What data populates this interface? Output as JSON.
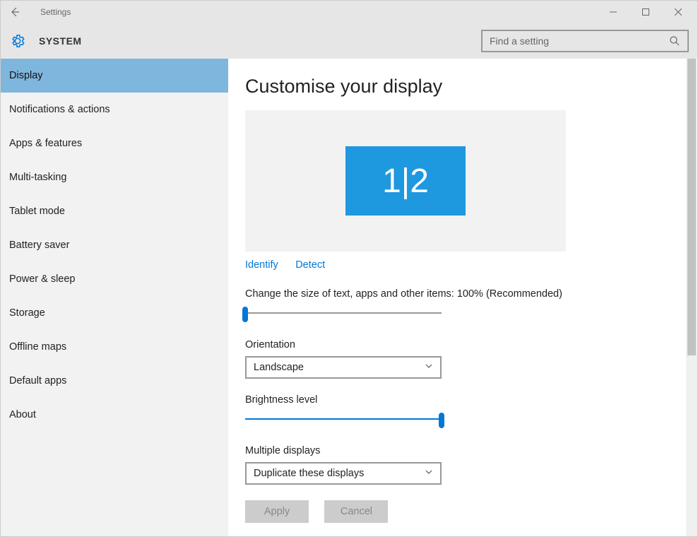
{
  "window": {
    "title": "Settings"
  },
  "header": {
    "title": "SYSTEM"
  },
  "search": {
    "placeholder": "Find a setting"
  },
  "sidebar": {
    "items": [
      {
        "label": "Display"
      },
      {
        "label": "Notifications & actions"
      },
      {
        "label": "Apps & features"
      },
      {
        "label": "Multi-tasking"
      },
      {
        "label": "Tablet mode"
      },
      {
        "label": "Battery saver"
      },
      {
        "label": "Power & sleep"
      },
      {
        "label": "Storage"
      },
      {
        "label": "Offline maps"
      },
      {
        "label": "Default apps"
      },
      {
        "label": "About"
      }
    ],
    "active_index": 0
  },
  "main": {
    "heading": "Customise your display",
    "monitor_label": "1|2",
    "links": {
      "identify": "Identify",
      "detect": "Detect"
    },
    "scale": {
      "label": "Change the size of text, apps and other items: 100% (Recommended)",
      "value_pct": 0
    },
    "orientation": {
      "label": "Orientation",
      "value": "Landscape"
    },
    "brightness": {
      "label": "Brightness level",
      "value_pct": 100
    },
    "multiple": {
      "label": "Multiple displays",
      "value": "Duplicate these displays"
    },
    "buttons": {
      "apply": "Apply",
      "cancel": "Cancel"
    }
  }
}
